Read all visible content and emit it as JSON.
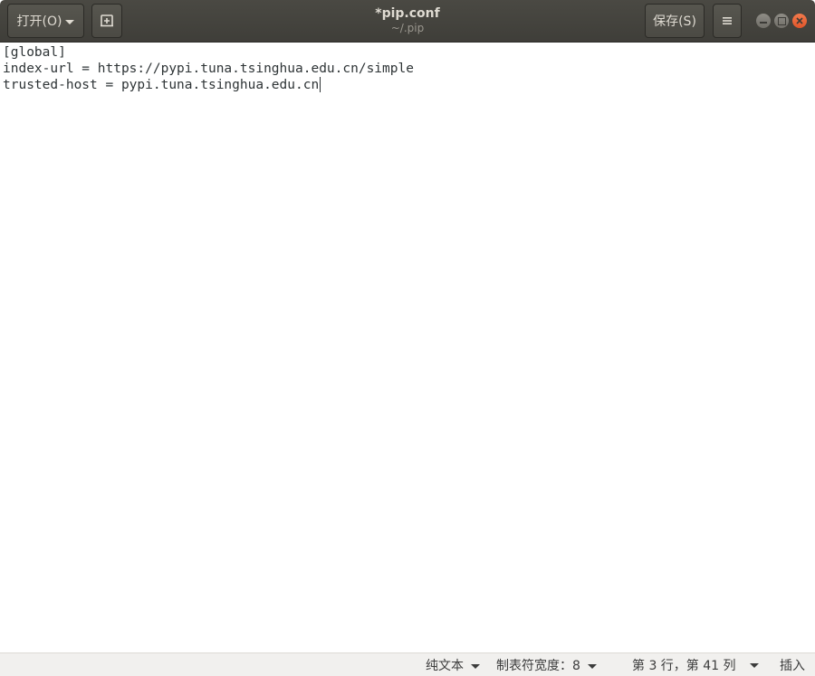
{
  "window": {
    "title": "*pip.conf",
    "subtitle": "~/.pip"
  },
  "header": {
    "open_label": "打开(O)",
    "save_label": "保存(S)"
  },
  "editor": {
    "lines": [
      "[global]",
      "index-url = https://pypi.tuna.tsinghua.edu.cn/simple",
      "trusted-host = pypi.tuna.tsinghua.edu.cn"
    ],
    "cursor": {
      "line": 3,
      "column": 41
    }
  },
  "statusbar": {
    "language": "纯文本",
    "tab_width": "制表符宽度：8",
    "position": "第 3 行，第 41 列",
    "insert_mode": "插入"
  },
  "icons": {
    "open_dropdown": "chevron-down-icon",
    "new_tab": "new-document-icon",
    "menu": "hamburger-menu-icon",
    "minimize": "minimize-icon",
    "maximize": "maximize-icon",
    "close": "close-icon"
  },
  "colors": {
    "headerbar": "#3f3e39",
    "close_button": "#e95420",
    "statusbar": "#f1f0ee",
    "text": "#2e3436"
  }
}
